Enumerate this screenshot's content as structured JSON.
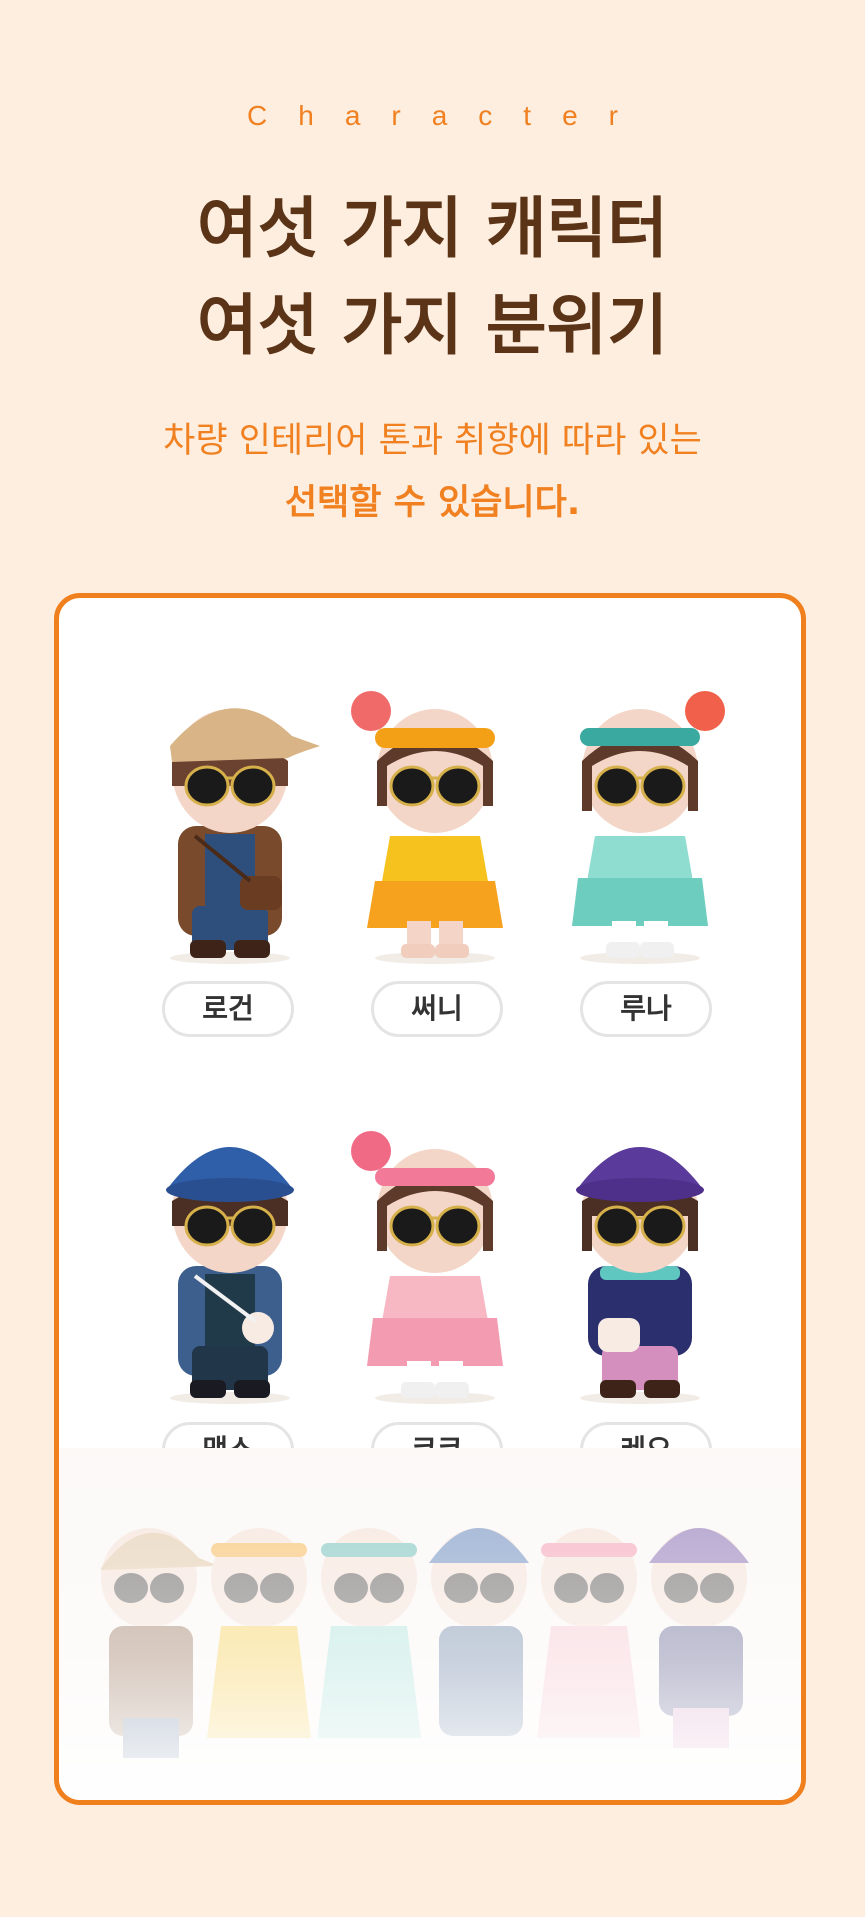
{
  "header": {
    "eyebrow": "Character",
    "title_line1": "여섯 가지 캐릭터",
    "title_line2": "여섯 가지 분위기",
    "subtitle_line1": "차량 인테리어 톤과 취향에 따라 있는",
    "subtitle_line2": "선택할 수 있습니다."
  },
  "characters": [
    {
      "name": "로건",
      "hat": "beige-knit-cap",
      "outfit": "brown-sweater-blue-pants"
    },
    {
      "name": "써니",
      "hat": "yellow-headband",
      "outfit": "yellow-sweater-orange-skirt"
    },
    {
      "name": "루나",
      "hat": "teal-headband",
      "outfit": "mint-ruffle-dress"
    },
    {
      "name": "맥스",
      "hat": "blue-beanie",
      "outfit": "blue-cardigan-navy-pants"
    },
    {
      "name": "코코",
      "hat": "pink-headband",
      "outfit": "pink-ruffle-dress"
    },
    {
      "name": "레오",
      "hat": "purple-beanie",
      "outfit": "navy-sweater-pink-pants"
    }
  ],
  "colors": {
    "background": "#fdeee0",
    "accent": "#f08020",
    "title": "#5b3418",
    "card_border": "#f0801e"
  }
}
